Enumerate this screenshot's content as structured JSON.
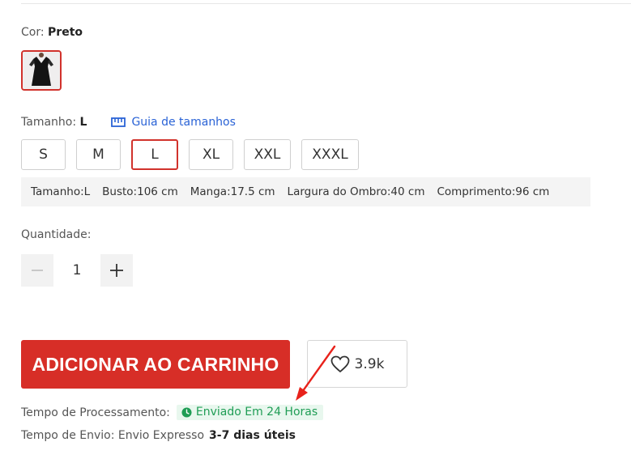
{
  "color": {
    "label": "Cor:",
    "value": "Preto"
  },
  "size": {
    "label": "Tamanho:",
    "value": "L",
    "guide_label": "Guia de tamanhos",
    "options": [
      "S",
      "M",
      "L",
      "XL",
      "XXL",
      "XXXL"
    ],
    "selected": "L"
  },
  "measurements": [
    "Tamanho:L",
    "Busto:106 cm",
    "Manga:17.5 cm",
    "Largura do Ombro:40 cm",
    "Comprimento:96 cm"
  ],
  "quantity": {
    "label": "Quantidade:",
    "value": "1"
  },
  "actions": {
    "add_to_cart": "ADICIONAR AO CARRINHO",
    "wishlist_count": "3.9k"
  },
  "processing": {
    "label": "Tempo de Processamento:",
    "badge": "Enviado Em 24 Horas"
  },
  "shipping": {
    "label": "Tempo de Envio: Envio Expresso",
    "days": "3-7 dias úteis"
  },
  "colors": {
    "accent_red": "#d72e27",
    "link_blue": "#2a63d6",
    "success_green": "#1f9d55"
  },
  "icons": [
    "ruler-icon",
    "minus-icon",
    "plus-icon",
    "heart-icon",
    "clock-icon",
    "annotation-arrow"
  ]
}
